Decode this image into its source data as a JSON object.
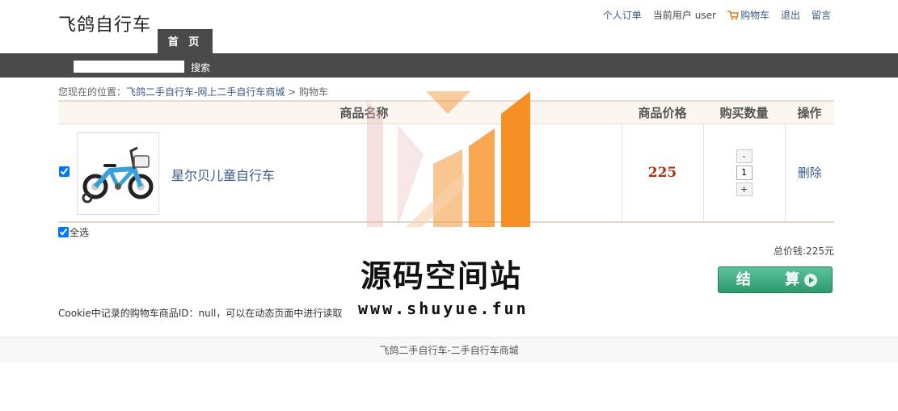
{
  "header": {
    "site_title": "飞鸽自行车",
    "links": {
      "orders": "个人订单",
      "current_user_prefix": "当前用户",
      "username": "user",
      "cart": "购物车",
      "logout": "退出",
      "message": "留言"
    }
  },
  "nav": {
    "home_tab": "首 页",
    "search_value": "",
    "search_button": "搜索"
  },
  "breadcrumb": {
    "prefix": "您现在的位置：",
    "home": "飞鸽二手自行车-网上二手自行车商城",
    "separator": " > ",
    "current": "购物车"
  },
  "cart_table": {
    "headers": {
      "name": "商品名称",
      "price": "商品价格",
      "quantity": "购买数量",
      "operation": "操作"
    },
    "items": [
      {
        "checked": true,
        "name": "星尔贝儿童自行车",
        "price": "225",
        "quantity": "1",
        "minus": "-",
        "plus": "+",
        "delete": "删除"
      }
    ]
  },
  "select_all": "全选",
  "total": "总价钱:225元",
  "checkout_button": "结 算",
  "cookie_note": "Cookie中记录的购物车商品ID：null，可以在动态页面中进行读取",
  "footer": "飞鸽二手自行车-二手自行车商城",
  "watermark": {
    "title": "源码空间站",
    "url": "www.shuyue.fun"
  },
  "colors": {
    "nav_bg": "#4a4a4a",
    "link": "#3a5a8a",
    "price": "#b03010",
    "checkout": "#2c9a6e",
    "watermark_orange": "#f5891a"
  },
  "icons": {
    "cart": "cart-icon",
    "checkout": "arrow-right-icon"
  }
}
